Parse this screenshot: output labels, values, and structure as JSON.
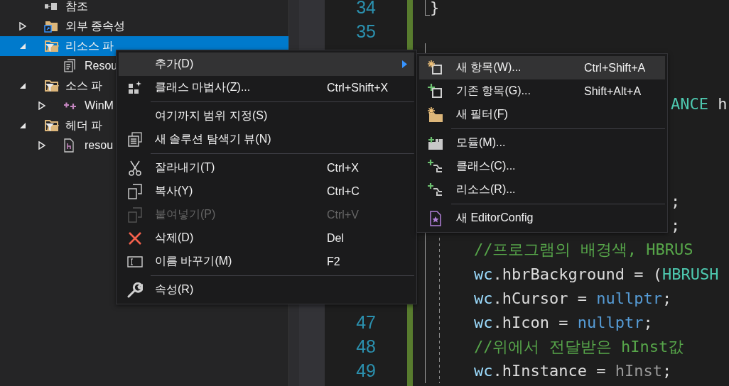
{
  "solution_explorer": {
    "items": [
      {
        "label": "참조",
        "kind": "references",
        "selected": false
      },
      {
        "label": "외부 종속성",
        "kind": "external",
        "expanded": false,
        "selected": false
      },
      {
        "label": "리소스 파",
        "kind": "filter",
        "expanded": true,
        "selected": true,
        "children": [
          {
            "label": "Resou",
            "kind": "resource",
            "selected": false
          }
        ]
      },
      {
        "label": "소스 파",
        "kind": "filter",
        "expanded": true,
        "selected": false,
        "children": [
          {
            "label": "WinM",
            "kind": "cpp",
            "expanded": false,
            "selected": false
          }
        ]
      },
      {
        "label": "헤더 파",
        "kind": "filter",
        "expanded": true,
        "selected": false,
        "children": [
          {
            "label": "resou",
            "kind": "header",
            "expanded": false,
            "selected": false
          }
        ]
      }
    ]
  },
  "editor": {
    "lines": [
      {
        "kind": "top",
        "number": "34",
        "tokens": [
          {
            "text": "}",
            "kind": "plain"
          }
        ]
      },
      {
        "kind": "blank",
        "number": "35"
      },
      {
        "kind": "hidden"
      },
      {
        "kind": "hidden"
      },
      {
        "kind": "partial",
        "tokens": [
          {
            "text": "ANCE",
            "kind": "type"
          },
          {
            "text": " h",
            "kind": "plain"
          }
        ]
      },
      {
        "kind": "hidden"
      },
      {
        "kind": "hidden"
      },
      {
        "kind": "hidden"
      },
      {
        "kind": "partial",
        "tokens": [
          {
            "text": ";",
            "kind": "plain"
          }
        ]
      },
      {
        "kind": "partial",
        "tokens": [
          {
            "text": ";",
            "kind": "plain"
          }
        ]
      },
      {
        "kind": "body",
        "tokens": [
          {
            "text": "//프로그램의 배경색, HBRUS",
            "kind": "comment"
          }
        ]
      },
      {
        "kind": "body",
        "tokens": [
          {
            "text": "wc",
            "kind": "variable"
          },
          {
            "text": ".hbrBackground = (",
            "kind": "plain"
          },
          {
            "text": "HBRUSH",
            "kind": "type"
          }
        ]
      },
      {
        "kind": "body",
        "tokens": [
          {
            "text": "wc",
            "kind": "variable"
          },
          {
            "text": ".hCursor = ",
            "kind": "plain"
          },
          {
            "text": "nullptr",
            "kind": "keyword"
          },
          {
            "text": ";",
            "kind": "plain"
          }
        ]
      },
      {
        "kind": "body",
        "number": "47",
        "tokens": [
          {
            "text": "wc",
            "kind": "variable"
          },
          {
            "text": ".hIcon = ",
            "kind": "plain"
          },
          {
            "text": "nullptr",
            "kind": "keyword"
          },
          {
            "text": ";",
            "kind": "plain"
          }
        ]
      },
      {
        "kind": "body",
        "number": "48",
        "tokens": [
          {
            "text": "//위에서 전달받은 hInst값",
            "kind": "comment"
          }
        ]
      },
      {
        "kind": "body",
        "number": "49",
        "tokens": [
          {
            "text": "wc",
            "kind": "variable"
          },
          {
            "text": ".hInstance = ",
            "kind": "plain"
          },
          {
            "text": "hInst",
            "kind": "parameter"
          },
          {
            "text": ";",
            "kind": "plain"
          }
        ]
      }
    ]
  },
  "context_menu": {
    "items": [
      {
        "kind": "item",
        "label": "추가(D)",
        "selected": true,
        "submenu": true,
        "disabled": false
      },
      {
        "kind": "item",
        "label": "클래스 마법사(Z)...",
        "shortcut": "Ctrl+Shift+X",
        "selected": false,
        "disabled": false
      },
      {
        "kind": "separator"
      },
      {
        "kind": "item",
        "label": "여기까지 범위 지정(S)",
        "selected": false,
        "disabled": false
      },
      {
        "kind": "item",
        "label": "새 솔루션 탐색기 뷰(N)",
        "selected": false,
        "disabled": false
      },
      {
        "kind": "separator"
      },
      {
        "kind": "item",
        "label": "잘라내기(T)",
        "shortcut": "Ctrl+X",
        "selected": false,
        "disabled": false
      },
      {
        "kind": "item",
        "label": "복사(Y)",
        "shortcut": "Ctrl+C",
        "selected": false,
        "disabled": false
      },
      {
        "kind": "item",
        "label": "붙여넣기(P)",
        "shortcut": "Ctrl+V",
        "selected": false,
        "disabled": true
      },
      {
        "kind": "item",
        "label": "삭제(D)",
        "shortcut": "Del",
        "selected": false,
        "disabled": false
      },
      {
        "kind": "item",
        "label": "이름 바꾸기(M)",
        "shortcut": "F2",
        "selected": false,
        "disabled": false
      },
      {
        "kind": "separator"
      },
      {
        "kind": "item",
        "label": "속성(R)",
        "selected": false,
        "disabled": false
      }
    ]
  },
  "submenu": {
    "items": [
      {
        "kind": "item",
        "label": "새 항목(W)...",
        "shortcut": "Ctrl+Shift+A",
        "selected": true
      },
      {
        "kind": "item",
        "label": "기존 항목(G)...",
        "shortcut": "Shift+Alt+A",
        "selected": false
      },
      {
        "kind": "item",
        "label": "새 필터(F)",
        "selected": false
      },
      {
        "kind": "separator"
      },
      {
        "kind": "item",
        "label": "모듈(M)...",
        "selected": false
      },
      {
        "kind": "item",
        "label": "클래스(C)...",
        "selected": false
      },
      {
        "kind": "item",
        "label": "리소스(R)...",
        "selected": false
      },
      {
        "kind": "separator"
      },
      {
        "kind": "item",
        "label": "새 EditorConfig",
        "selected": false
      }
    ]
  }
}
